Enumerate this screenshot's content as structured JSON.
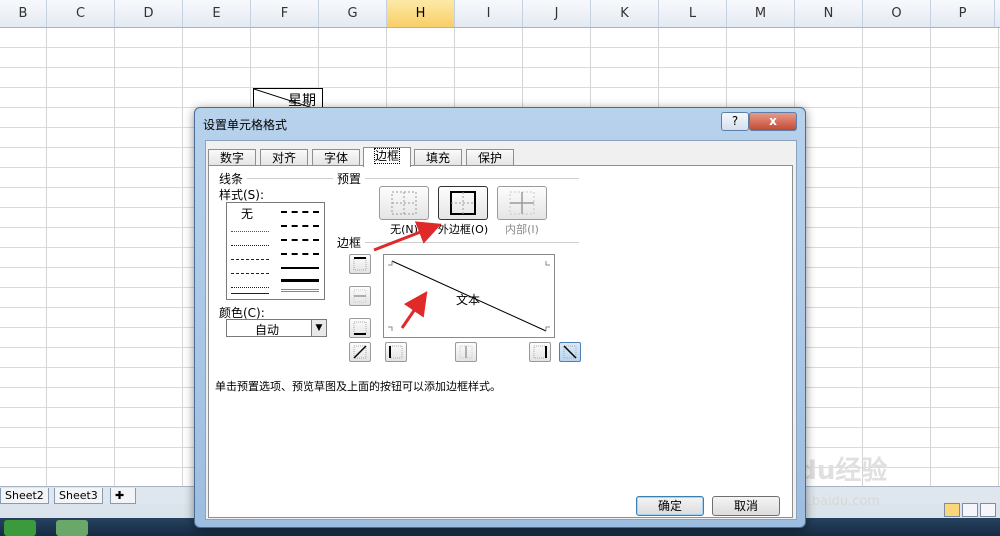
{
  "columns": [
    {
      "label": "B",
      "w": 47
    },
    {
      "label": "C",
      "w": 68
    },
    {
      "label": "D",
      "w": 68
    },
    {
      "label": "E",
      "w": 68
    },
    {
      "label": "F",
      "w": 68
    },
    {
      "label": "G",
      "w": 68
    },
    {
      "label": "H",
      "w": 68,
      "selected": true
    },
    {
      "label": "I",
      "w": 68
    },
    {
      "label": "J",
      "w": 68
    },
    {
      "label": "K",
      "w": 68
    },
    {
      "label": "L",
      "w": 68
    },
    {
      "label": "M",
      "w": 68
    },
    {
      "label": "N",
      "w": 68
    },
    {
      "label": "O",
      "w": 68
    },
    {
      "label": "P",
      "w": 64
    }
  ],
  "cell": {
    "text": "星期"
  },
  "sheets": [
    "Sheet2",
    "Sheet3"
  ],
  "dialog": {
    "title": "设置单元格格式",
    "help": "?",
    "close": "x",
    "tabs": [
      "数字",
      "对齐",
      "字体",
      "边框",
      "填充",
      "保护"
    ],
    "active_tab": "边框",
    "line_group": "线条",
    "style_label": "样式(S):",
    "style_none": "无",
    "color_label": "颜色(C):",
    "color_value": "自动",
    "preset_group": "预置",
    "presets": [
      {
        "label": "无(N)",
        "name": "preset-none"
      },
      {
        "label": "外边框(O)",
        "name": "preset-outline"
      },
      {
        "label": "内部(I)",
        "name": "preset-inside"
      }
    ],
    "border_group": "边框",
    "preview_text": "文本",
    "hint": "单击预置选项、预览草图及上面的按钮可以添加边框样式。",
    "ok": "确定",
    "cancel": "取消"
  },
  "watermark": {
    "brand": "Baidu经验",
    "url": "jingyan.baidu.com"
  },
  "colors": {
    "accent": "#3c7fb1",
    "arrow": "#e02a2a",
    "selected_col": "#f8cf68"
  }
}
